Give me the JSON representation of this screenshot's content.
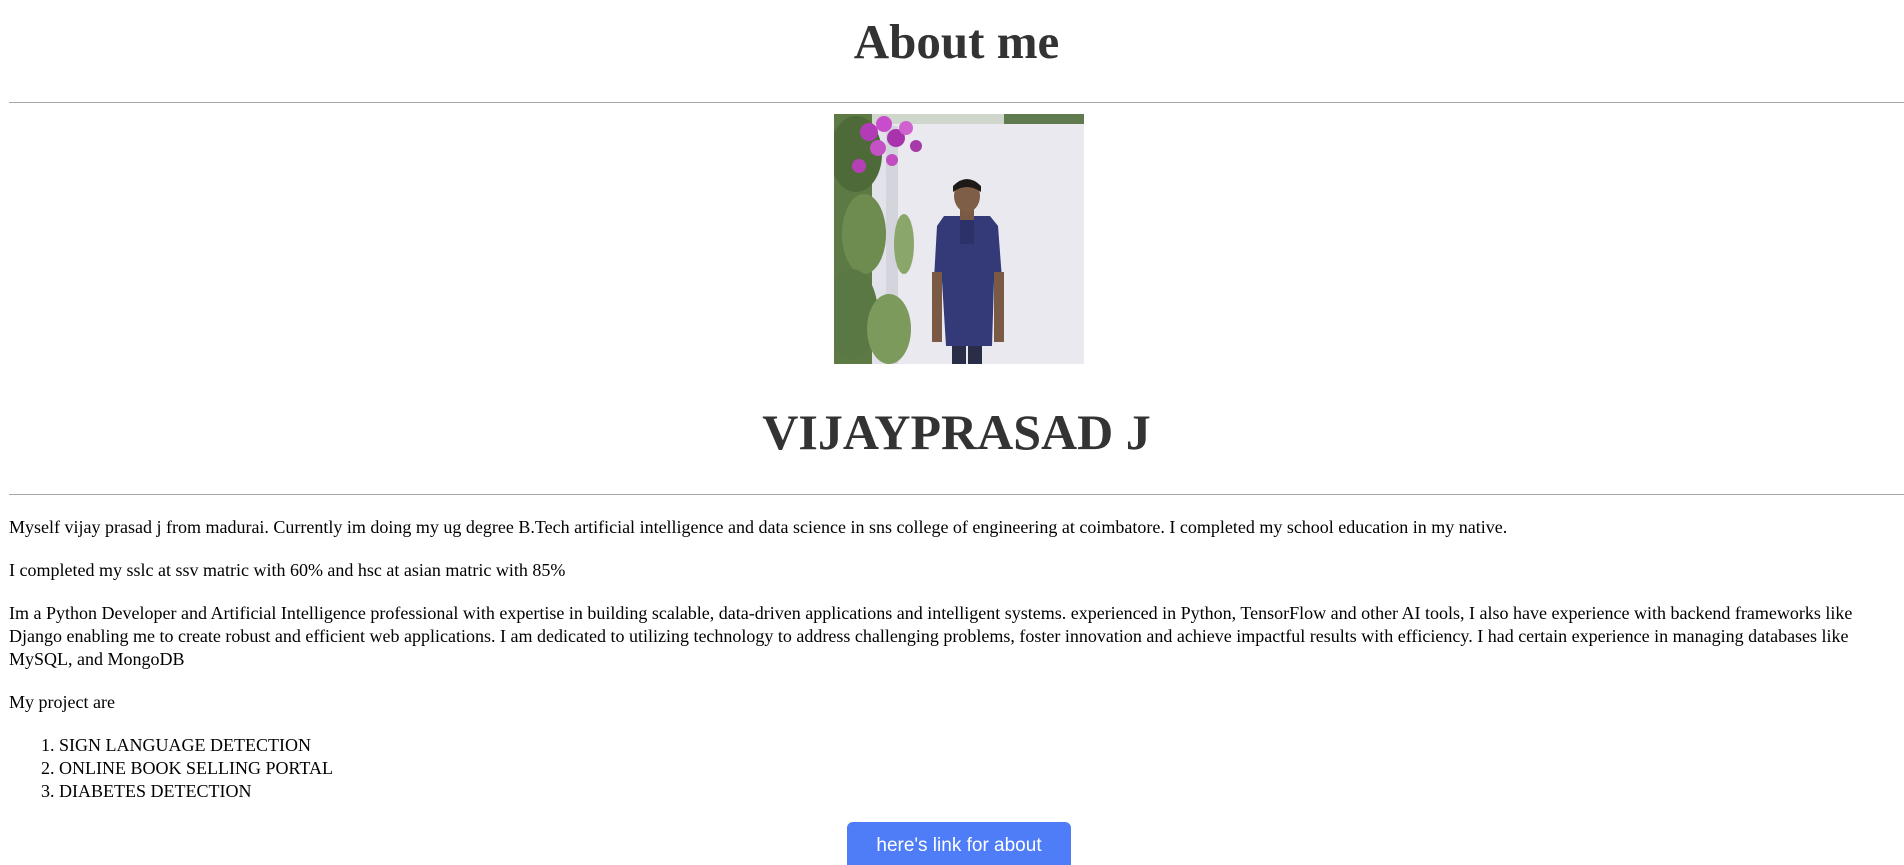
{
  "header": {
    "title": "About me"
  },
  "profile": {
    "name": "VIJAYPRASAD J"
  },
  "bio": {
    "paragraphs": [
      "Myself vijay prasad j from madurai. Currently im doing my ug degree B.Tech artificial intelligence and data science in sns college of engineering at coimbatore. I completed my school education in my native.",
      "I completed my sslc at ssv matric with 60% and hsc at asian matric with 85%",
      "Im a Python Developer and Artificial Intelligence professional with expertise in building scalable, data-driven applications and intelligent systems. experienced in Python, TensorFlow and other AI tools, I also have experience with backend frameworks like Django enabling me to create robust and efficient web applications. I am dedicated to utilizing technology to address challenging problems, foster innovation and achieve impactful results with efficiency. I had certain experience in managing databases like MySQL, and MongoDB",
      "My project are"
    ],
    "projects": [
      "SIGN LANGUAGE DETECTION",
      "ONLINE BOOK SELLING PORTAL",
      "DIABETES DETECTION"
    ]
  },
  "actions": {
    "about_link_label": "here's link for about"
  },
  "colors": {
    "heading": "#333333",
    "button_bg": "#4f7cf7",
    "button_text": "#ffffff",
    "rule": "#a8a8a8"
  }
}
